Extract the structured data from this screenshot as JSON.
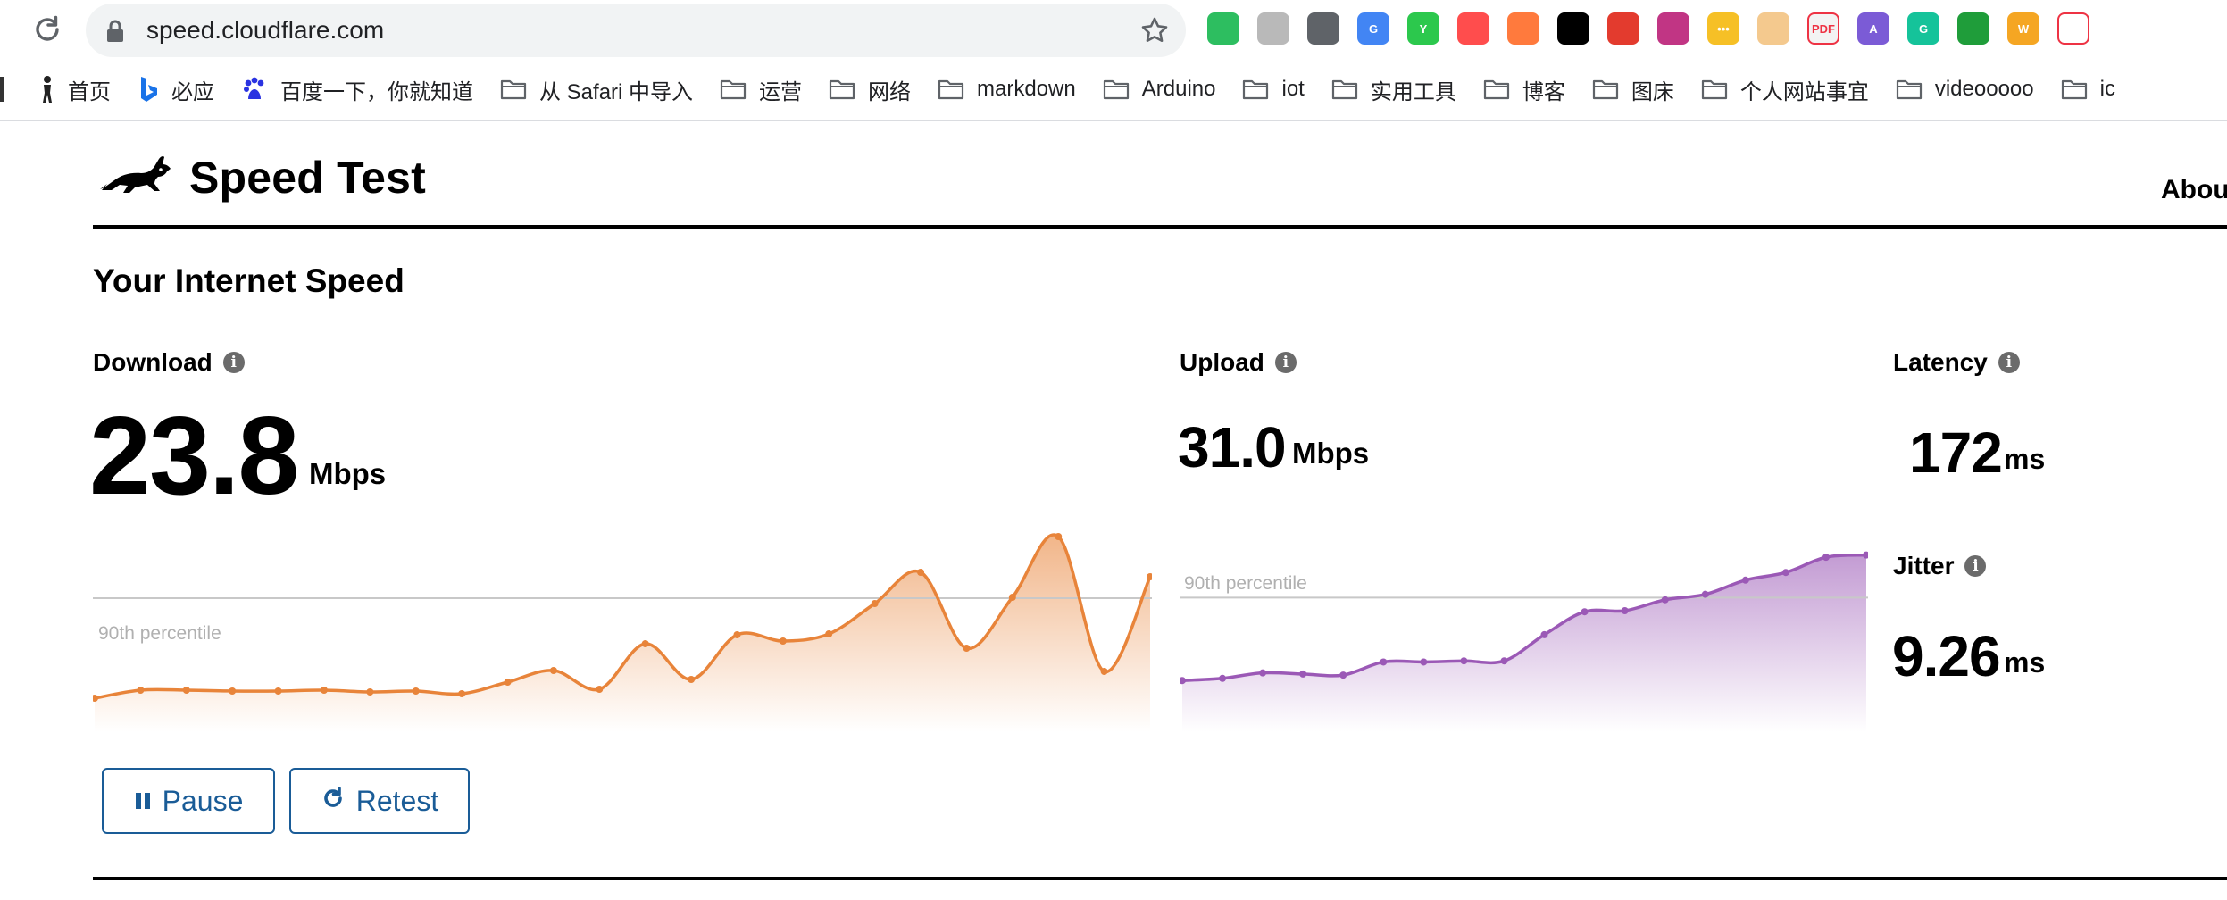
{
  "browser": {
    "url": "speed.cloudflare.com",
    "bookmarks": [
      {
        "label": "首页",
        "icon": "person-icon"
      },
      {
        "label": "必应",
        "icon": "bing-icon"
      },
      {
        "label": "百度一下，你就知道",
        "icon": "baidu-icon"
      },
      {
        "label": "从 Safari 中导入",
        "icon": "folder-icon"
      },
      {
        "label": "运营",
        "icon": "folder-icon"
      },
      {
        "label": "网络",
        "icon": "folder-icon"
      },
      {
        "label": "markdown",
        "icon": "folder-icon"
      },
      {
        "label": "Arduino",
        "icon": "folder-icon"
      },
      {
        "label": "iot",
        "icon": "folder-icon"
      },
      {
        "label": "实用工具",
        "icon": "folder-icon"
      },
      {
        "label": "博客",
        "icon": "folder-icon"
      },
      {
        "label": "图床",
        "icon": "folder-icon"
      },
      {
        "label": "个人网站事宜",
        "icon": "folder-icon"
      },
      {
        "label": "videooooo",
        "icon": "folder-icon"
      },
      {
        "label": "ic",
        "icon": "folder-icon"
      }
    ],
    "extensions": [
      {
        "name": "evernote-icon",
        "color": "#2dbe60",
        "text": ""
      },
      {
        "name": "shield-extension-icon",
        "color": "#b9b9b9",
        "text": ""
      },
      {
        "name": "clipboard-extension-icon",
        "color": "#5f6368",
        "text": ""
      },
      {
        "name": "google-translate-icon",
        "color": "#4285f4",
        "text": "G"
      },
      {
        "name": "y-extension-icon",
        "color": "#2cc84d",
        "text": "Y"
      },
      {
        "name": "crop-extension-icon",
        "color": "#ff4d4d",
        "text": ""
      },
      {
        "name": "orange-extension-icon",
        "color": "#ff7a3d",
        "text": ""
      },
      {
        "name": "tampermonkey-icon",
        "color": "#000000",
        "text": ""
      },
      {
        "name": "block-extension-icon",
        "color": "#e33b2e",
        "text": ""
      },
      {
        "name": "color-picker-icon",
        "color": "#c13584",
        "text": ""
      },
      {
        "name": "dots-extension-icon",
        "color": "#f6c026",
        "text": "•••"
      },
      {
        "name": "cat-extension-icon",
        "color": "#f4c98e",
        "text": ""
      },
      {
        "name": "pdf-extension-icon",
        "color": "#f3f3f3",
        "text": "PDF"
      },
      {
        "name": "a-extension-icon",
        "color": "#7b5bd6",
        "text": "A"
      },
      {
        "name": "grammarly-icon",
        "color": "#15c39a",
        "text": "G"
      },
      {
        "name": "figure-extension-icon",
        "color": "#1f9d3a",
        "text": ""
      },
      {
        "name": "w-extension-icon",
        "color": "#f5a623",
        "text": "W"
      },
      {
        "name": "b-extension-icon",
        "color": "#ffffff",
        "text": ""
      }
    ]
  },
  "page": {
    "brand": "Speed Test",
    "nav_about": "Abou",
    "section_title": "Your Internet Speed",
    "accent_download": "#e8843a",
    "accent_upload": "#9b59b6",
    "button_color": "#1a5c97"
  },
  "metrics": {
    "download": {
      "label": "Download",
      "value": "23.8",
      "unit": "Mbps"
    },
    "upload": {
      "label": "Upload",
      "value": "31.0",
      "unit": "Mbps"
    },
    "latency": {
      "label": "Latency",
      "value": "172",
      "unit": "ms"
    },
    "jitter": {
      "label": "Jitter",
      "value": "9.26",
      "unit": "ms"
    }
  },
  "buttons": {
    "pause": "Pause",
    "retest": "Retest"
  },
  "chart_data": [
    {
      "type": "area",
      "series": [
        {
          "values": [
            17.4,
            18.3,
            18.3,
            18.2,
            18.2,
            18.3,
            18.1,
            18.2,
            17.9,
            19.2,
            20.5,
            18.4,
            23.5,
            19.5,
            24.5,
            23.8,
            24.6,
            28.0,
            31.5,
            23.0,
            28.7,
            35.5,
            20.4,
            31.0
          ]
        }
      ],
      "annotation": "90th percentile",
      "percentile_90": 28.6,
      "ylim": [
        14,
        36
      ],
      "color": "#e8843a"
    },
    {
      "type": "area",
      "series": [
        {
          "values": [
            20.4,
            20.6,
            21.1,
            21.0,
            20.9,
            22.1,
            22.1,
            22.2,
            22.2,
            24.6,
            26.7,
            26.8,
            27.8,
            28.3,
            29.6,
            30.3,
            31.7,
            31.9
          ]
        }
      ],
      "annotation": "90th percentile",
      "percentile_90": 28.0,
      "ylim": [
        16,
        34
      ],
      "color": "#9b59b6"
    }
  ]
}
